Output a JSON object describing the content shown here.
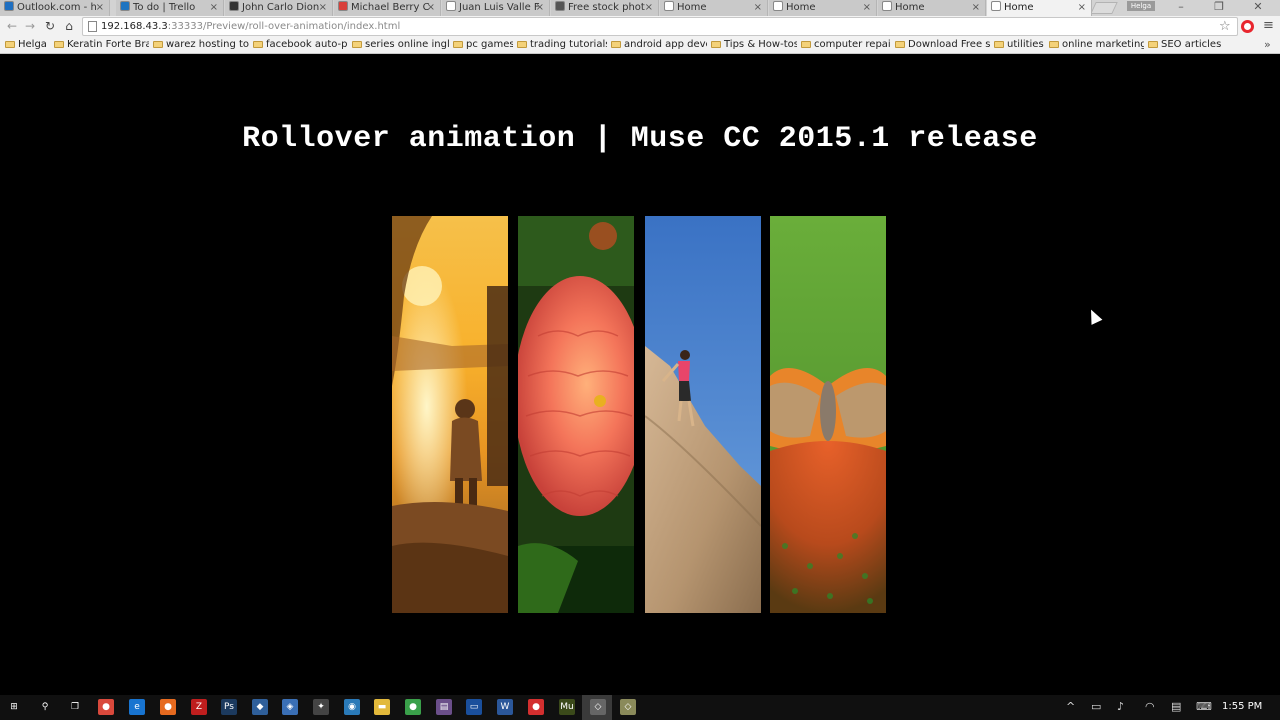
{
  "browser": {
    "tabs": [
      {
        "label": "Outlook.com - h",
        "color": "#1e6fc1"
      },
      {
        "label": "To do | Trello",
        "color": "#1e74c0"
      },
      {
        "label": "John Carlo Dion",
        "color": "#333333"
      },
      {
        "label": "Michael Berry C",
        "color": "#d8403a",
        "glyph": "M"
      },
      {
        "label": "Juan Luis Valle F",
        "color": "#ffffff"
      },
      {
        "label": "Free stock phot",
        "color": "#555555"
      },
      {
        "label": "Home",
        "color": "#ffffff"
      },
      {
        "label": "Home",
        "color": "#ffffff"
      },
      {
        "label": "Home",
        "color": "#ffffff"
      },
      {
        "label": "Home",
        "color": "#ffffff"
      }
    ],
    "tab_close": "×",
    "profile": "Helga",
    "window": {
      "minimize": "–",
      "restore": "❐",
      "close": "✕"
    },
    "nav": {
      "back": "←",
      "forward": "→",
      "reload": "↻",
      "home": "⌂"
    },
    "address": {
      "host": "192.168.43.3",
      "rest": ":33333/Preview/roll-over-animation/index.html"
    },
    "star": "☆",
    "menu": "≡",
    "bookmarks": [
      "Helga",
      "Keratin Forte Braz",
      "warez hosting to",
      "facebook auto-po",
      "series online ingle",
      "pc games",
      "trading tutorials",
      "android app deve",
      "Tips & How-tos",
      "computer repair",
      "Download Free st",
      "utilities",
      "online marketing",
      "SEO articles"
    ],
    "bookmarks_more": "»"
  },
  "page": {
    "title": "Rollover animation | Muse CC 2015.1 release",
    "panels": [
      {
        "name": "sunset-child-photo"
      },
      {
        "name": "dahlia-flower-photo"
      },
      {
        "name": "rock-climber-photo"
      },
      {
        "name": "butterfly-photo"
      }
    ]
  },
  "taskbar": {
    "apps": [
      {
        "name": "windows-start-icon",
        "glyph": "⊞",
        "color": "#101010"
      },
      {
        "name": "search-icon",
        "glyph": "⚲",
        "color": "#101010"
      },
      {
        "name": "task-view-icon",
        "glyph": "❐",
        "color": "#101010"
      },
      {
        "name": "chrome-icon",
        "glyph": "●",
        "color": "#d9493c"
      },
      {
        "name": "edge-icon",
        "glyph": "e",
        "color": "#1874d0"
      },
      {
        "name": "firefox-icon",
        "glyph": "●",
        "color": "#e66a1f"
      },
      {
        "name": "filezilla-icon",
        "glyph": "Z",
        "color": "#bf1e1e"
      },
      {
        "name": "photoshop-icon",
        "glyph": "Ps",
        "color": "#1c3a5e"
      },
      {
        "name": "3d-box-icon",
        "glyph": "◆",
        "color": "#2f5f9a"
      },
      {
        "name": "security-icon",
        "glyph": "◈",
        "color": "#3a6fb5"
      },
      {
        "name": "tool-icon",
        "glyph": "✦",
        "color": "#444444"
      },
      {
        "name": "browser-icon",
        "glyph": "◉",
        "color": "#2a7ab8"
      },
      {
        "name": "file-explorer-icon",
        "glyph": "▬",
        "color": "#e2b93b"
      },
      {
        "name": "green-app-icon",
        "glyph": "●",
        "color": "#3aa04a"
      },
      {
        "name": "archive-icon",
        "glyph": "▤",
        "color": "#6b4f8a"
      },
      {
        "name": "keyboard-app-icon",
        "glyph": "▭",
        "color": "#1a4f9c"
      },
      {
        "name": "word-icon",
        "glyph": "W",
        "color": "#2b579a"
      },
      {
        "name": "red-app-icon",
        "glyph": "●",
        "color": "#d32f2f"
      },
      {
        "name": "muse-icon",
        "glyph": "Mu",
        "color": "#3b4a1a"
      },
      {
        "name": "active-app-icon",
        "glyph": "◇",
        "color": "#666666"
      },
      {
        "name": "extra-app-icon",
        "glyph": "◇",
        "color": "#8a8a5a"
      }
    ],
    "clock": "1:55 PM"
  }
}
